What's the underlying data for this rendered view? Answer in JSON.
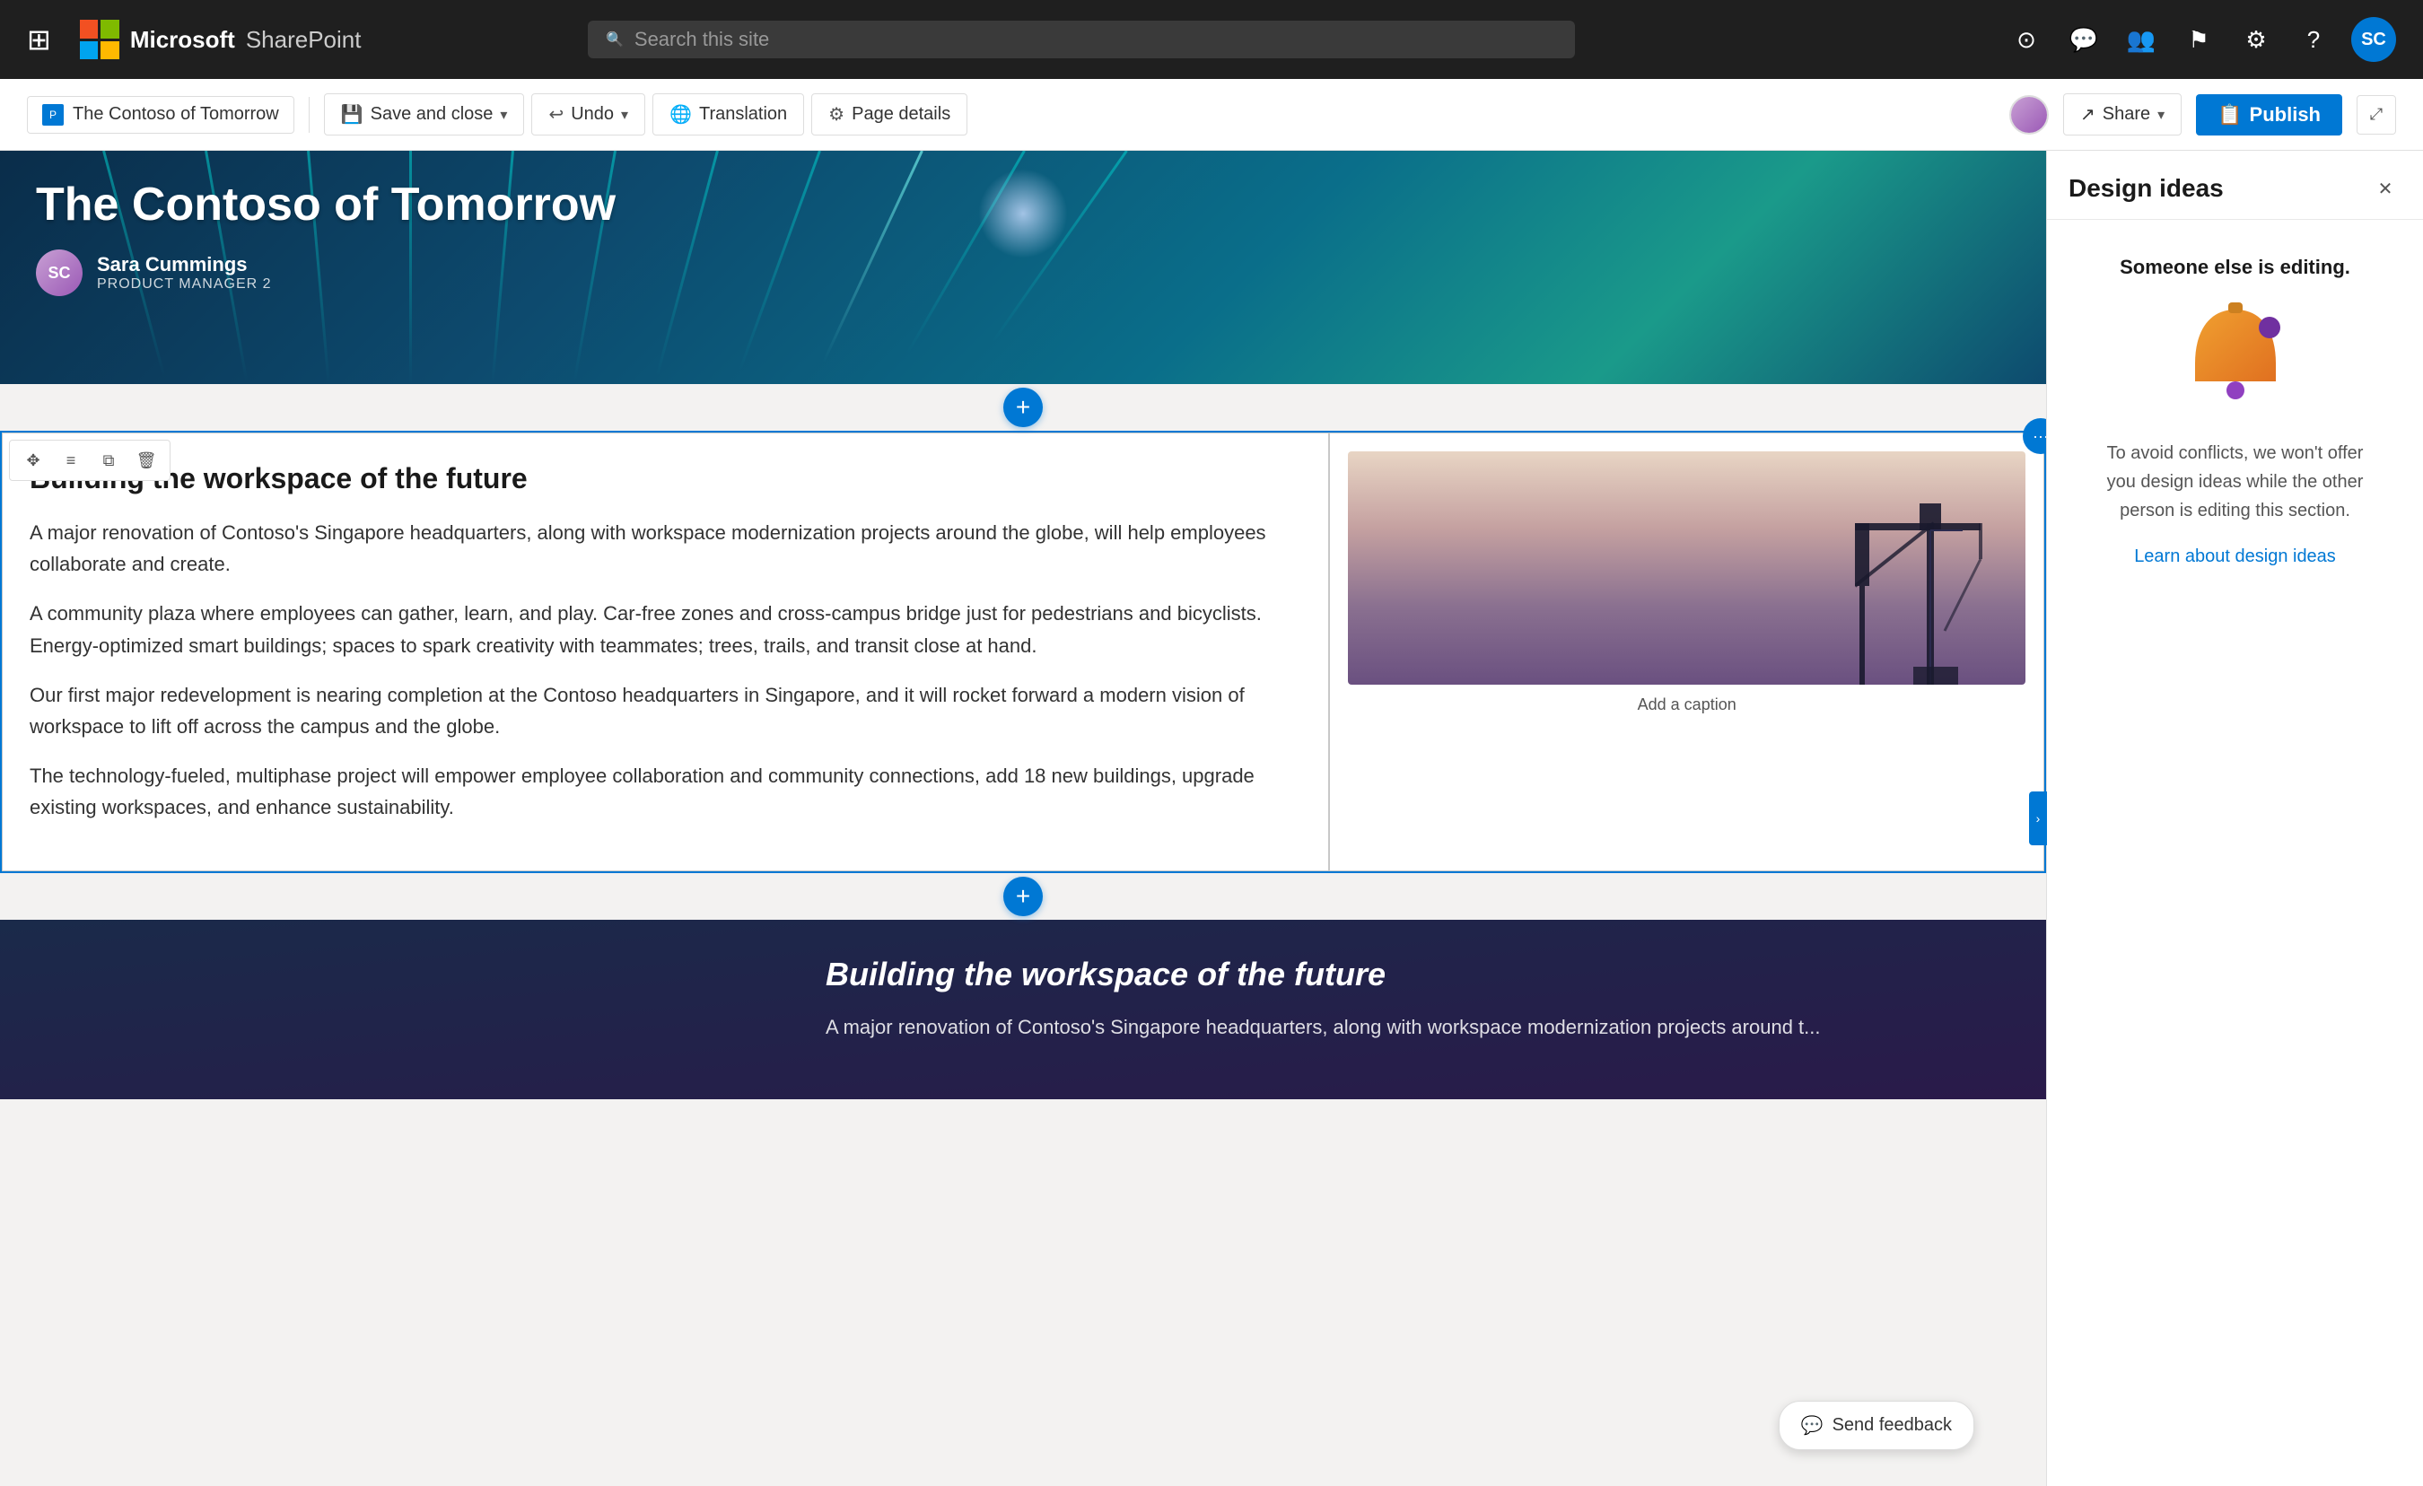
{
  "nav": {
    "waffle_label": "⊞",
    "brand": "Microsoft",
    "product": "SharePoint",
    "search_placeholder": "Search this site",
    "icons": [
      "accessibility",
      "feedback",
      "people",
      "flag",
      "settings",
      "help"
    ],
    "avatar_initials": "SC"
  },
  "toolbar": {
    "page_tab": "The Contoso of Tomorrow",
    "save_close_label": "Save and close",
    "undo_label": "Undo",
    "translation_label": "Translation",
    "page_details_label": "Page details",
    "share_label": "Share",
    "publish_label": "Publish"
  },
  "hero": {
    "title": "The Contoso of Tomorrow",
    "author_name": "Sara Cummings",
    "author_role": "Product Manager 2"
  },
  "content": {
    "heading": "Building the workspace of the future",
    "para1": "A major renovation of Contoso's Singapore headquarters, along with workspace modernization projects around the globe, will help employees collaborate and create.",
    "para2": "A community plaza where employees can gather, learn, and play. Car-free zones and cross-campus bridge just for pedestrians and bicyclists. Energy-optimized smart buildings; spaces to spark creativity with teammates; trees, trails, and transit close at hand.",
    "para3": "Our first major redevelopment is nearing completion at the Contoso headquarters in Singapore, and it will rocket forward a modern vision of workspace to lift off across the campus and the globe.",
    "para4": "The technology-fueled, multiphase project will empower employee collaboration and community connections, add 18 new buildings, upgrade existing workspaces, and enhance sustainability.",
    "image_caption": "Add a caption"
  },
  "dark_section": {
    "title": "Building the workspace of the future",
    "para": "A major renovation of Contoso's Singapore headquarters, along with workspace modernization projects around t..."
  },
  "design_panel": {
    "title": "Design ideas",
    "editing_notice": "Someone else is editing.",
    "description": "To avoid conflicts, we won't offer you design ideas while the other person is editing this section.",
    "learn_link": "Learn about design ideas"
  },
  "feedback": {
    "label": "Send feedback"
  },
  "section_tools": {
    "move": "✥",
    "settings": "≡",
    "copy": "⧉",
    "delete": "🗑"
  }
}
